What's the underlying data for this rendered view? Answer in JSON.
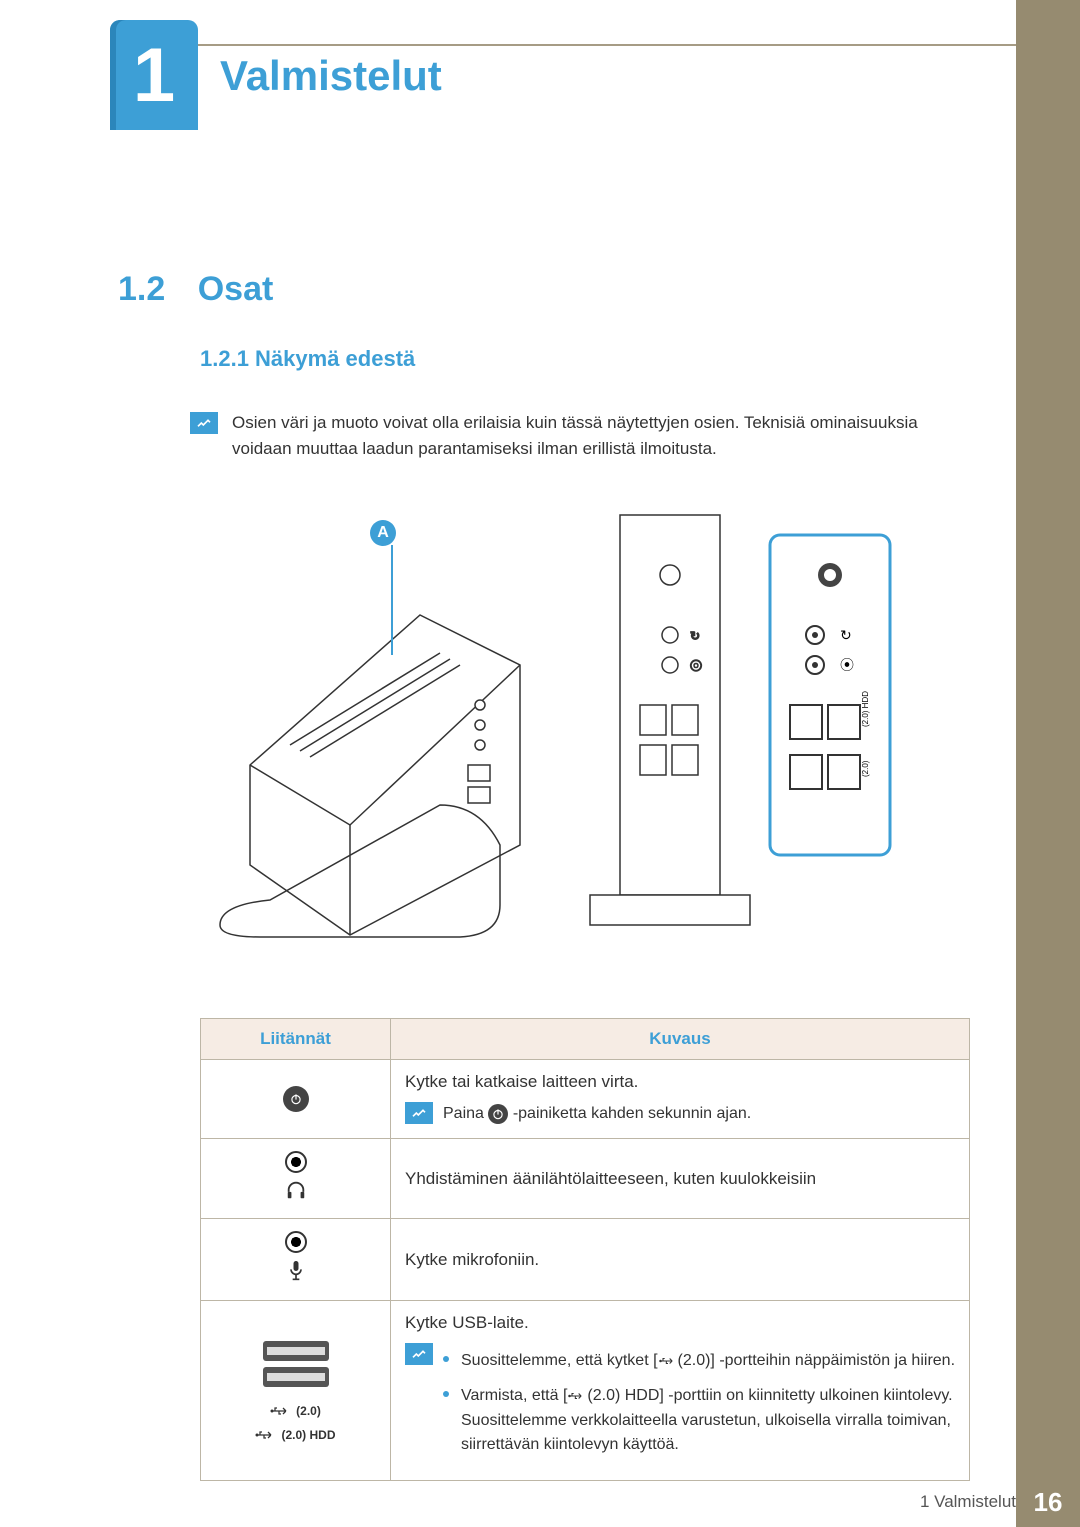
{
  "chapter": {
    "number": "1",
    "title": "Valmistelut"
  },
  "section": {
    "number": "1.2",
    "title": "Osat"
  },
  "subsection": {
    "number": "1.2.1",
    "title": "Näkymä edestä",
    "full": "1.2.1 Näkymä edestä"
  },
  "note": "Osien väri ja muoto voivat olla erilaisia kuin tässä näytettyjen osien. Teknisiä ominaisuuksia voidaan muuttaa laadun parantamiseksi ilman erillistä ilmoitusta.",
  "callout_a": "A",
  "table": {
    "headers": {
      "ports": "Liitännät",
      "desc": "Kuvaus"
    },
    "rows": [
      {
        "port_name": "power-button",
        "desc_line1": "Kytke tai katkaise laitteen virta.",
        "note_prefix": "Paina ",
        "note_suffix": "-painiketta kahden sekunnin ajan."
      },
      {
        "port_name": "headphone-jack",
        "desc": "Yhdistäminen äänilähtölaitteeseen, kuten kuulokkeisiin"
      },
      {
        "port_name": "mic-jack",
        "desc": "Kytke mikrofoniin."
      },
      {
        "port_name": "usb-ports",
        "usb_labels": {
          "a": "(2.0)",
          "b": "(2.0) HDD"
        },
        "desc_line1": "Kytke USB-laite.",
        "bullet1_pre": "Suosittelemme, että kytket [",
        "bullet1_mid": "(2.0)] -portteihin näppäimistön ja hiiren.",
        "bullet2_pre": "Varmista, että [",
        "bullet2_mid": "(2.0) HDD] -porttiin on kiinnitetty ulkoinen kiintolevy. Suosittelemme verkkolaitteella varustetun, ulkoisella virralla toimivan, siirrettävän kiintolevyn käyttöä."
      }
    ]
  },
  "footer": {
    "title": "1 Valmistelut",
    "page": "16"
  }
}
